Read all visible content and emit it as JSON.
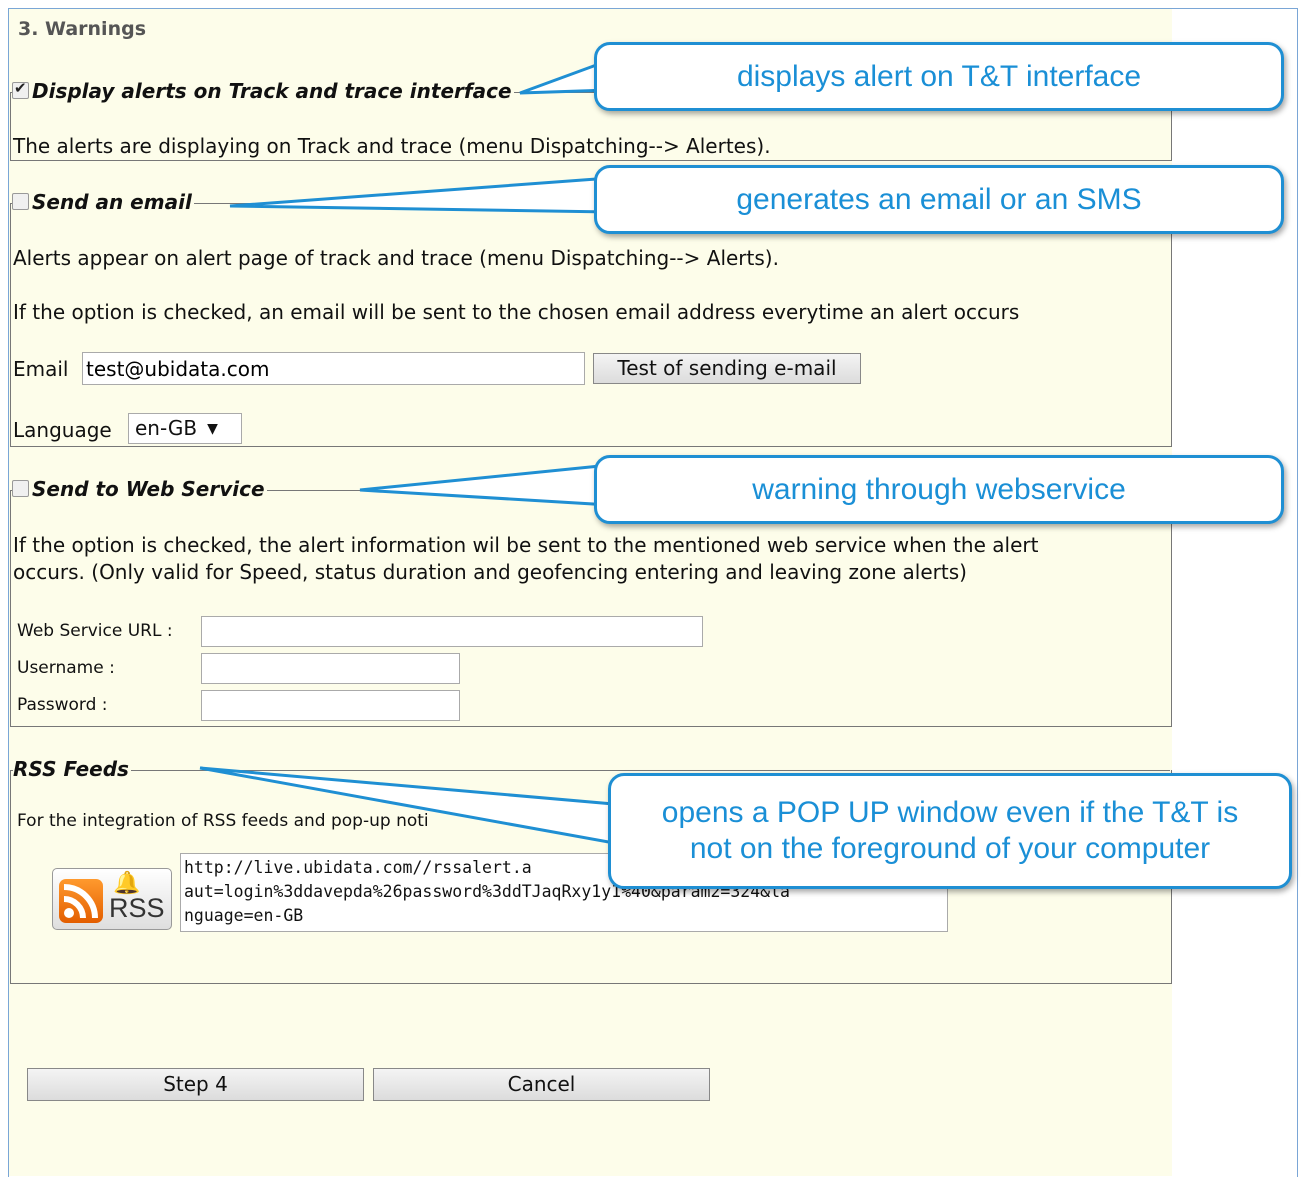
{
  "section": {
    "title": "3. Warnings"
  },
  "display_alerts": {
    "legend": "Display alerts on Track and trace interface",
    "checked": true,
    "description": "The alerts are displaying on Track and trace (menu Dispatching--> Alertes)."
  },
  "send_email": {
    "legend": "Send an email",
    "checked": false,
    "description1": "Alerts appear on alert page of track and trace (menu Dispatching--> Alerts).",
    "description2": "If the option is checked, an email will be sent to the chosen email address everytime an alert occurs",
    "email_label": "Email",
    "email_value": "test@ubidata.com",
    "test_button": "Test of sending  e-mail",
    "language_label": "Language",
    "language_value": "en-GB"
  },
  "web_service": {
    "legend": "Send to Web Service",
    "checked": false,
    "description1": "If the option is checked, the alert information wil be sent to the mentioned web service when the alert",
    "description2": "occurs. (Only valid for Speed, status duration and geofencing entering and leaving zone alerts)",
    "url_label": "Web Service URL :",
    "username_label": "Username :",
    "password_label": "Password :",
    "url_value": "",
    "username_value": "",
    "password_value": ""
  },
  "rss": {
    "legend": "RSS Feeds",
    "description": "For the integration of RSS feeds and pop-up noti",
    "icon_label": "RSS",
    "url_line1": "http://live.ubidata.com//rssalert.a",
    "url_line2": "aut=login%3ddavepda%26password%3ddTJaqRxy1y1%40&param2=324&la",
    "url_line3": "nguage=en-GB"
  },
  "buttons": {
    "step4": "Step 4",
    "cancel": "Cancel"
  },
  "callouts": {
    "c1": "displays alert on T&T interface",
    "c2": "generates an email or an SMS",
    "c3": "warning through webservice",
    "c4_line1": "opens a POP UP window even if the T&T is",
    "c4_line2": "not on the foreground of your computer"
  },
  "colors": {
    "callout_border": "#1f8fd3",
    "callout_text": "#1a8fd6",
    "panel_bg": "#fdfdea"
  }
}
